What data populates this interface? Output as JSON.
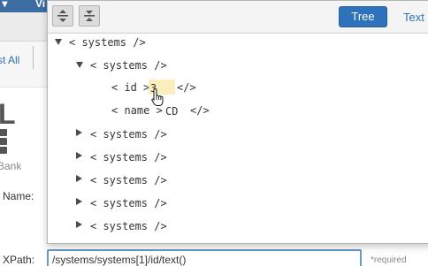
{
  "background": {
    "menu": {
      "item1": "t ▾",
      "item2": "Vi"
    },
    "subbar": {
      "link": "st All"
    },
    "logo_letter": "L",
    "db_label": "Bank",
    "name_label": "Name:",
    "xpath": {
      "label": "XPath:",
      "value": "/systems/systems[1]/id/text()",
      "required": "*required"
    }
  },
  "popup": {
    "toolbar": {
      "tree_label": "Tree",
      "text_label": "Text"
    },
    "tree": {
      "root": "< systems />",
      "child_open": "< systems />",
      "id_open": "< id >",
      "id_value": "3",
      "id_close": "</>",
      "name_open": "< name >",
      "name_value": "CD",
      "name_close": "</>",
      "collapsed": [
        "< systems />",
        "< systems />",
        "< systems />",
        "< systems />",
        "< systems />"
      ]
    }
  },
  "colors": {
    "accent": "#2e72bb",
    "highlight": "#fbeebb",
    "menubar": "#3b6da3"
  },
  "icons": [
    "expand-all-icon",
    "collapse-all-icon",
    "database-icon",
    "mouse-cursor-icon"
  ]
}
